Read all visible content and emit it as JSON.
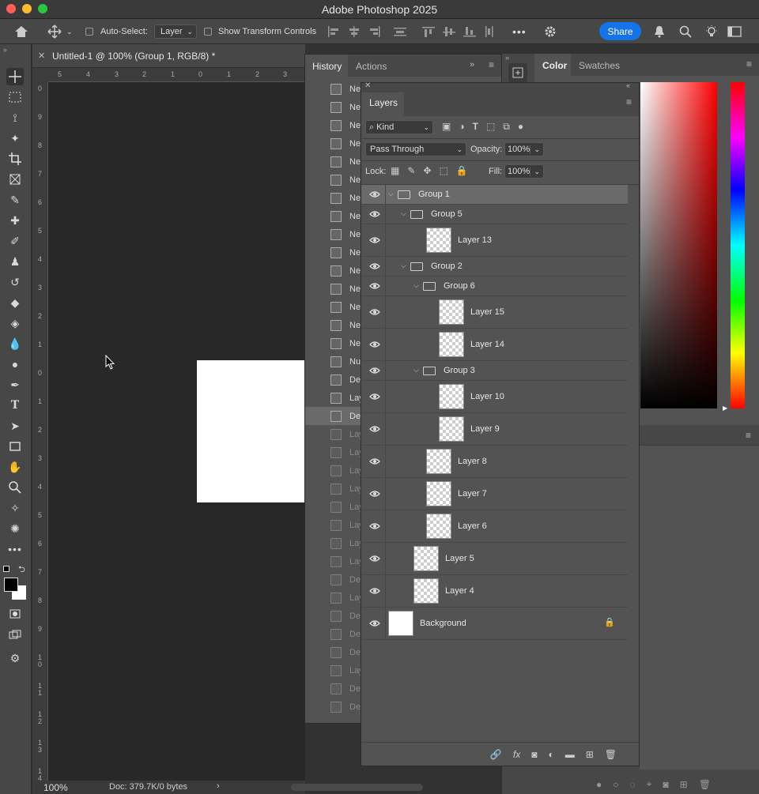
{
  "window": {
    "title": "Adobe Photoshop 2025"
  },
  "options_bar": {
    "auto_select_label": "Auto-Select:",
    "auto_select_value": "Layer",
    "show_transform_label": "Show Transform Controls",
    "more_label": "•••",
    "share_label": "Share"
  },
  "document": {
    "tab_title": "Untitled-1 @ 100% (Group 1, RGB/8) *",
    "zoom": "100%",
    "doc_info": "Doc: 379.7K/0 bytes",
    "ruler_h": [
      "5",
      "4",
      "3",
      "2",
      "1",
      "0",
      "1",
      "2",
      "3"
    ],
    "ruler_v": [
      "0",
      "9",
      "8",
      "7",
      "6",
      "5",
      "4",
      "3",
      "2",
      "1",
      "0",
      "1",
      "2",
      "3",
      "4",
      "5",
      "6",
      "7",
      "8",
      "9",
      "1\n0",
      "1\n1",
      "1\n2",
      "1\n3",
      "1\n4"
    ]
  },
  "history": {
    "tabs": [
      "History",
      "Actions"
    ],
    "items": [
      "Ne",
      "Ne",
      "Ne",
      "Ne",
      "Ne",
      "Ne",
      "Ne",
      "Ne",
      "Ne",
      "Ne",
      "Ne",
      "Ne",
      "Ne",
      "Ne",
      "Ne",
      "Nu",
      "De",
      "Lay",
      "De",
      "Lay",
      "Lay",
      "Lay",
      "Lay",
      "Lay",
      "Lay",
      "Lay",
      "Lay",
      "De",
      "Lay",
      "De",
      "De",
      "De",
      "Lay",
      "De",
      "De"
    ]
  },
  "layers_panel": {
    "title": "Layers",
    "filter_kind": "Kind",
    "blend_mode": "Pass Through",
    "opacity_label": "Opacity:",
    "opacity_value": "100%",
    "lock_label": "Lock:",
    "fill_label": "Fill:",
    "fill_value": "100%",
    "layers": [
      {
        "name": "Group 1",
        "type": "group",
        "indent": 0
      },
      {
        "name": "Group 5",
        "type": "group",
        "indent": 1
      },
      {
        "name": "Layer 13",
        "type": "layer",
        "indent": 2
      },
      {
        "name": "Group 2",
        "type": "group",
        "indent": 1
      },
      {
        "name": "Group 6",
        "type": "group",
        "indent": 2
      },
      {
        "name": "Layer 15",
        "type": "layer",
        "indent": 3
      },
      {
        "name": "Layer 14",
        "type": "layer",
        "indent": 3
      },
      {
        "name": "Group 3",
        "type": "group",
        "indent": 2
      },
      {
        "name": "Layer 10",
        "type": "layer",
        "indent": 3
      },
      {
        "name": "Layer 9",
        "type": "layer",
        "indent": 3
      },
      {
        "name": "Layer 8",
        "type": "layer",
        "indent": 2
      },
      {
        "name": "Layer 7",
        "type": "layer",
        "indent": 2
      },
      {
        "name": "Layer 6",
        "type": "layer",
        "indent": 2
      },
      {
        "name": "Layer 5",
        "type": "layer",
        "indent": 1
      },
      {
        "name": "Layer 4",
        "type": "layer",
        "indent": 1
      },
      {
        "name": "Background",
        "type": "background",
        "indent": 0
      }
    ]
  },
  "color_panel": {
    "tabs": [
      "Color",
      "Swatches"
    ]
  },
  "colors": {
    "accent": "#1473e6",
    "panel": "#535353",
    "selected_row": "#6a6a6a"
  }
}
